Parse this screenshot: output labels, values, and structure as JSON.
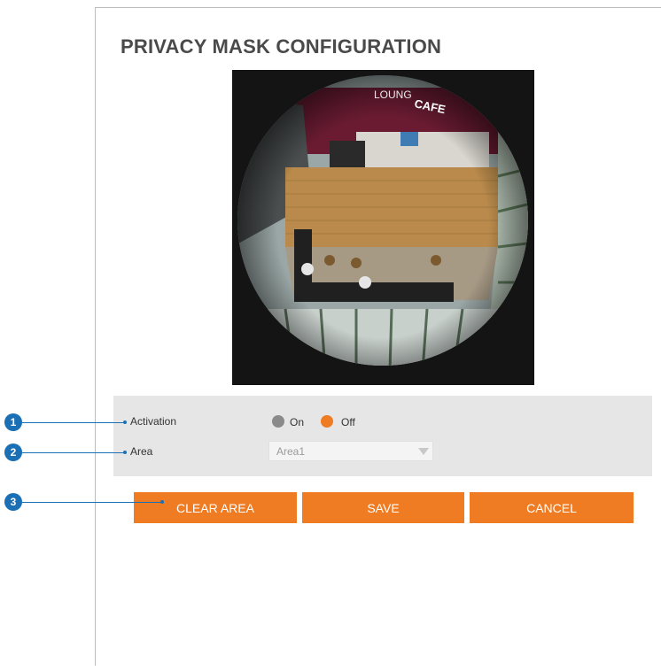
{
  "page": {
    "title": "PRIVACY MASK CONFIGURATION"
  },
  "camera": {
    "sign_text_1": "LOUNG",
    "sign_text_2": "CAFE"
  },
  "settings": {
    "activation": {
      "label": "Activation",
      "options": [
        "On",
        "Off"
      ],
      "selected": "Off"
    },
    "area": {
      "label": "Area",
      "value": "Area1"
    }
  },
  "buttons": {
    "clear_area": "CLEAR AREA",
    "save": "SAVE",
    "cancel": "CANCEL"
  },
  "callouts": [
    "1",
    "2",
    "3"
  ],
  "colors": {
    "accent": "#ef7b22",
    "callout": "#1a6fb5",
    "panel": "#e6e6e6"
  }
}
